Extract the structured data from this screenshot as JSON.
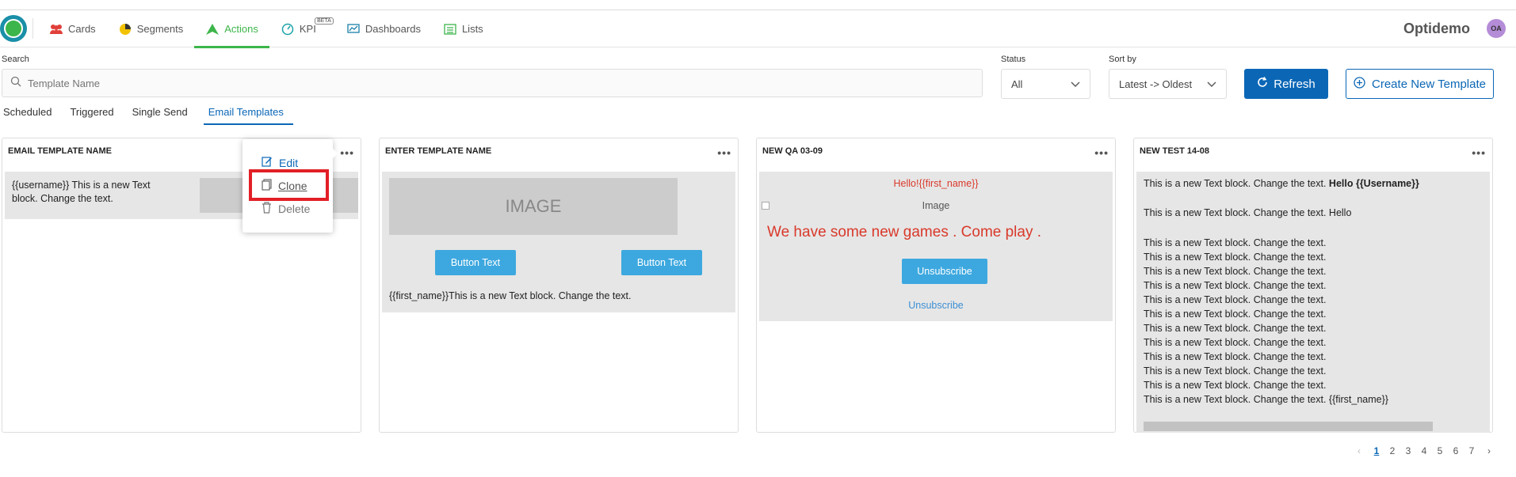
{
  "nav": {
    "items": [
      {
        "label": "Cards",
        "icon": "users-icon"
      },
      {
        "label": "Segments",
        "icon": "pie-icon"
      },
      {
        "label": "Actions",
        "icon": "send-icon"
      },
      {
        "label": "KPI",
        "icon": "gauge-icon",
        "badge": "BETA"
      },
      {
        "label": "Dashboards",
        "icon": "dashboard-icon"
      },
      {
        "label": "Lists",
        "icon": "list-icon"
      }
    ],
    "brand": "Optidemo",
    "avatar": "OA"
  },
  "filters": {
    "search_label": "Search",
    "search_placeholder": "Template Name",
    "status_label": "Status",
    "status_value": "All",
    "sort_label": "Sort by",
    "sort_value": "Latest -> Oldest",
    "refresh_label": "Refresh",
    "create_label": "Create New Template"
  },
  "tabs": [
    "Scheduled",
    "Triggered",
    "Single Send",
    "Email Templates"
  ],
  "cards": [
    {
      "title": "EMAIL TEMPLATE NAME",
      "text": "{{username}} This is a new Text block. Change the text."
    },
    {
      "title": "ENTER TEMPLATE NAME",
      "image_label": "IMAGE",
      "button1": "Button Text",
      "button2": "Button Text",
      "text": "{{first_name}}This is a new Text block. Change the text."
    },
    {
      "title": "NEW QA 03-09",
      "hello": "Hello!{{first_name}}",
      "image_alt": "Image",
      "headline": "We have some new games . Come play .",
      "unsubscribe_button": "Unsubscribe",
      "unsubscribe_link": "Unsubscribe"
    },
    {
      "title": "NEW TEST 14-08",
      "line1_prefix": "This is a new Text block. Change the text. ",
      "line1_bold": "Hello {{Username}}",
      "line2": "This is a new Text block. Change the text. Hello",
      "lines": [
        "This is a new Text block. Change the text.",
        "This is a new Text block. Change the text.",
        "This is a new Text block. Change the text.",
        "This is a new Text block. Change the text.",
        "This is a new Text block. Change the text.",
        "This is a new Text block. Change the text.",
        "This is a new Text block. Change the text.",
        "This is a new Text block. Change the text.",
        "This is a new Text block. Change the text.",
        "This is a new Text block. Change the text.",
        "This is a new Text block. Change the text.",
        "This is a new Text block. Change the text. {{first_name}}"
      ]
    }
  ],
  "card_menu_icon": "ellipsis-icon",
  "context_menu": {
    "edit": "Edit",
    "clone": "Clone",
    "delete": "Delete"
  },
  "pagination": {
    "pages": [
      "1",
      "2",
      "3",
      "4",
      "5",
      "6",
      "7"
    ],
    "current": "1"
  },
  "colors": {
    "accent": "#0b67b6",
    "actions_active": "#3cb54a",
    "highlight": "#e21f26",
    "headline_red": "#d9392b",
    "button_blue": "#3da8df"
  }
}
